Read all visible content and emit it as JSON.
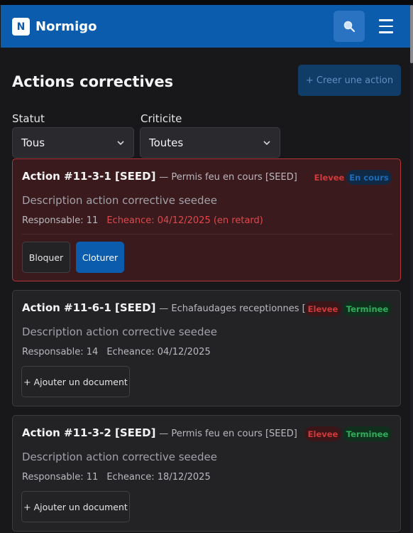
{
  "app": {
    "logo_letter": "N",
    "brand": "Normigo"
  },
  "header": {
    "search_icon": "search-icon",
    "menu_icon": "hamburger-menu-icon"
  },
  "page": {
    "title": "Actions correctives",
    "create_button": "+ Creer une action"
  },
  "filters": {
    "status": {
      "label": "Statut",
      "value": "Tous"
    },
    "criticity": {
      "label": "Criticite",
      "value": "Toutes"
    }
  },
  "actions": [
    {
      "id": "Action #11-3-1 [SEED]",
      "context": "— Permis feu en cours [SEED]",
      "criticity": "Elevee",
      "status": "En cours",
      "description": "Description action corrective seedee",
      "owner": "Responsable: 11",
      "deadline": "Echeance: 04/12/2025 (en retard)",
      "buttons": [
        "Bloquer",
        "Cloturer"
      ]
    },
    {
      "id": "Action #11-6-1 [SEED]",
      "context": "— Echafaudages receptionnes [SEED]",
      "criticity": "Elevee",
      "status": "Terminee",
      "description": "Description action corrective seedee",
      "owner": "Responsable: 14",
      "deadline": "Echeance: 04/12/2025",
      "buttons": [
        "+ Ajouter un document"
      ]
    },
    {
      "id": "Action #11-3-2 [SEED]",
      "context": "— Permis feu en cours [SEED]",
      "criticity": "Elevee",
      "status": "Terminee",
      "description": "Description action corrective seedee",
      "owner": "Responsable: 11",
      "deadline": "Echeance: 18/12/2025",
      "buttons": [
        "+ Ajouter un document"
      ]
    }
  ],
  "colors": {
    "brand": "#0b5cad",
    "late": "#e0484d",
    "done": "#2fae5c"
  }
}
